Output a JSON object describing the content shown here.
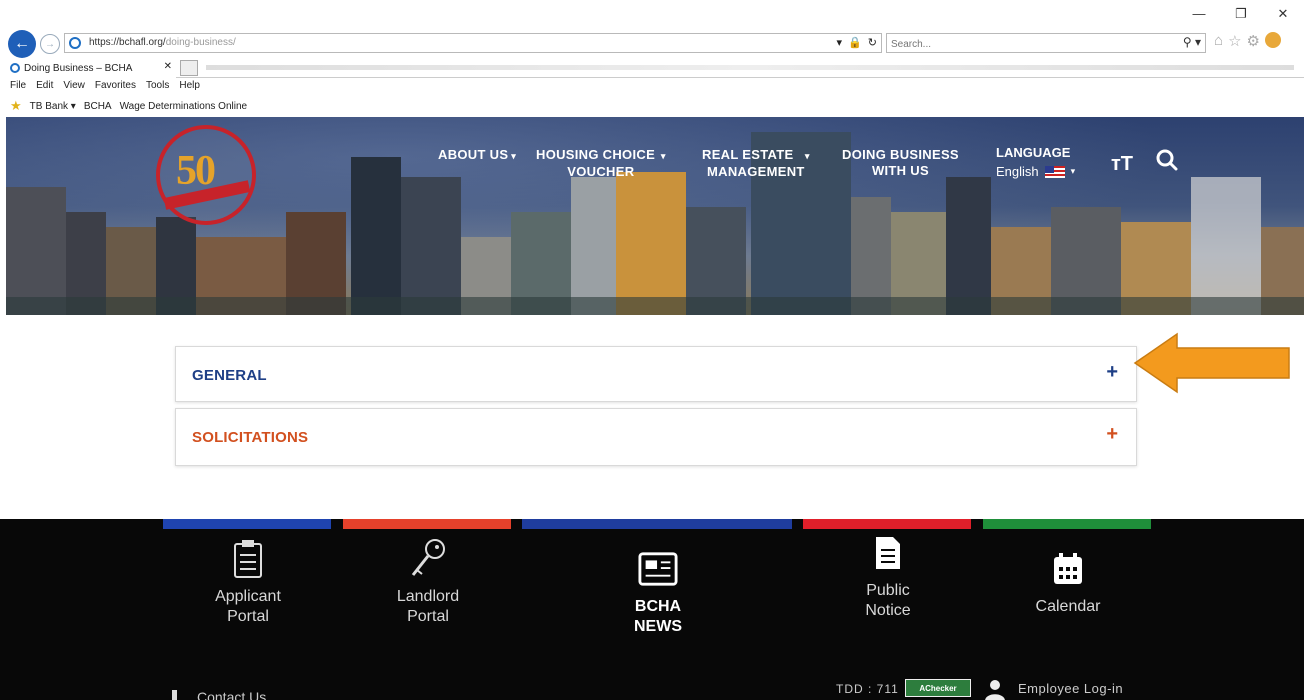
{
  "browser": {
    "url": "https://bchafl.org/doing-business/",
    "url_host": "https://bchafl.org/",
    "url_path": "doing-business/",
    "search_placeholder": "Search...",
    "tab_title": "Doing Business – BCHA",
    "window_controls": [
      "—",
      "❐",
      "✕"
    ],
    "menu": [
      "File",
      "Edit",
      "View",
      "Favorites",
      "Tools",
      "Help"
    ],
    "favorites": [
      "TB Bank ▾",
      "BCHA",
      "Wage Determinations Online"
    ]
  },
  "header": {
    "logo_text": "50",
    "nav": [
      {
        "label": "ABOUT US",
        "has_caret": true
      },
      {
        "label": "HOUSING CHOICE",
        "label2": "VOUCHER",
        "has_caret": true
      },
      {
        "label": "REAL ESTATE",
        "label2": "MANAGEMENT",
        "has_caret": true
      },
      {
        "label": "DOING BUSINESS",
        "label2": "WITH US",
        "has_caret": false
      }
    ],
    "language_label": "LANGUAGE",
    "language_value": "English"
  },
  "main": {
    "accordion": [
      {
        "label": "GENERAL",
        "icon": "+"
      },
      {
        "label": "SOLICITATIONS",
        "icon": "+"
      }
    ]
  },
  "footer": {
    "stripe_colors": [
      "#1f44b0",
      "#e5412b",
      "#1f3d9e",
      "#e01f2a",
      "#1f8f3a"
    ],
    "links": [
      {
        "line1": "Applicant",
        "line2": "Portal",
        "icon": "clipboard-icon"
      },
      {
        "line1": "Landlord",
        "line2": "Portal",
        "icon": "key-icon"
      },
      {
        "line1": "BCHA",
        "line2": "NEWS",
        "icon": "newspaper-icon"
      },
      {
        "line1": "Public",
        "line2": "Notice",
        "icon": "document-icon"
      },
      {
        "line1": "Calendar",
        "line2": "",
        "icon": "calendar-icon"
      }
    ],
    "contact": "Contact Us",
    "tdd": "TDD : 711",
    "achecker": "AChecker",
    "employee_login": "Employee Log-in"
  },
  "colors": {
    "general": "#1e3f86",
    "solicitations": "#d2501f",
    "arrow": "#f39a1e"
  }
}
